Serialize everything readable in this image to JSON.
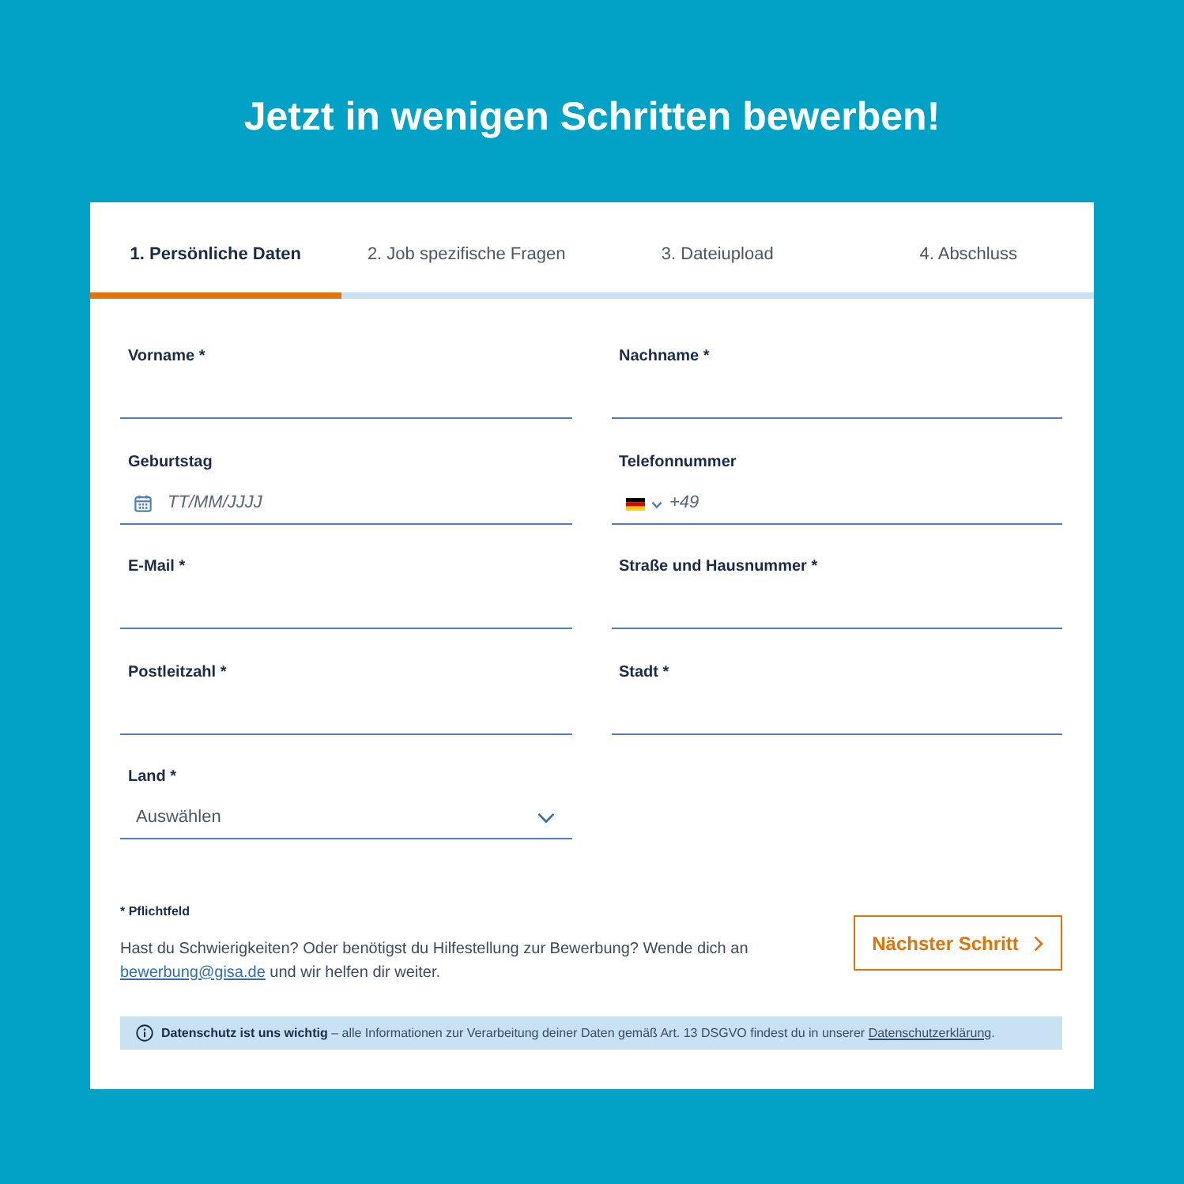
{
  "heading": "Jetzt in wenigen Schritten bewerben!",
  "steps": [
    {
      "label": "1. Persönliche Daten",
      "selected": true
    },
    {
      "label": "2. Job spezifische Fragen",
      "selected": false
    },
    {
      "label": "3. Dateiupload",
      "selected": false
    },
    {
      "label": "4. Abschluss",
      "selected": false
    }
  ],
  "fields": [
    {
      "kind": "text",
      "label": "Vorname *"
    },
    {
      "kind": "text",
      "label": "Nachname *"
    },
    {
      "kind": "date",
      "label": "Geburtstag",
      "placeholder": "TT/MM/JJJJ"
    },
    {
      "kind": "phone",
      "label": "Telefonnummer",
      "placeholder": "+49"
    },
    {
      "kind": "text",
      "label": "E-Mail *"
    },
    {
      "kind": "text",
      "label": "Straße und Hausnummer *"
    },
    {
      "kind": "text",
      "label": "Postleitzahl *"
    },
    {
      "kind": "text",
      "label": "Stadt *"
    },
    {
      "kind": "select",
      "label": "Land *",
      "value": "Auswählen"
    }
  ],
  "required_note": "* Pflichtfeld",
  "help": {
    "text": "Hast du Schwierigkeiten? Oder benötigst du Hilfestellung zur Bewerbung? Wende dich an",
    "link": "bewerbung@gisa.de",
    "text_after": "und wir helfen dir weiter."
  },
  "next_button": {
    "label": "Nächster Schritt"
  },
  "privacy_notice": {
    "title": "Datenschutz ist uns wichtig",
    "text": "– alle Informationen zur Verarbeitung deiner Daten gemäß Art. 13 DSGVO findest du in unserer",
    "link": "Datenschutzerklärung",
    "text_after": "."
  }
}
